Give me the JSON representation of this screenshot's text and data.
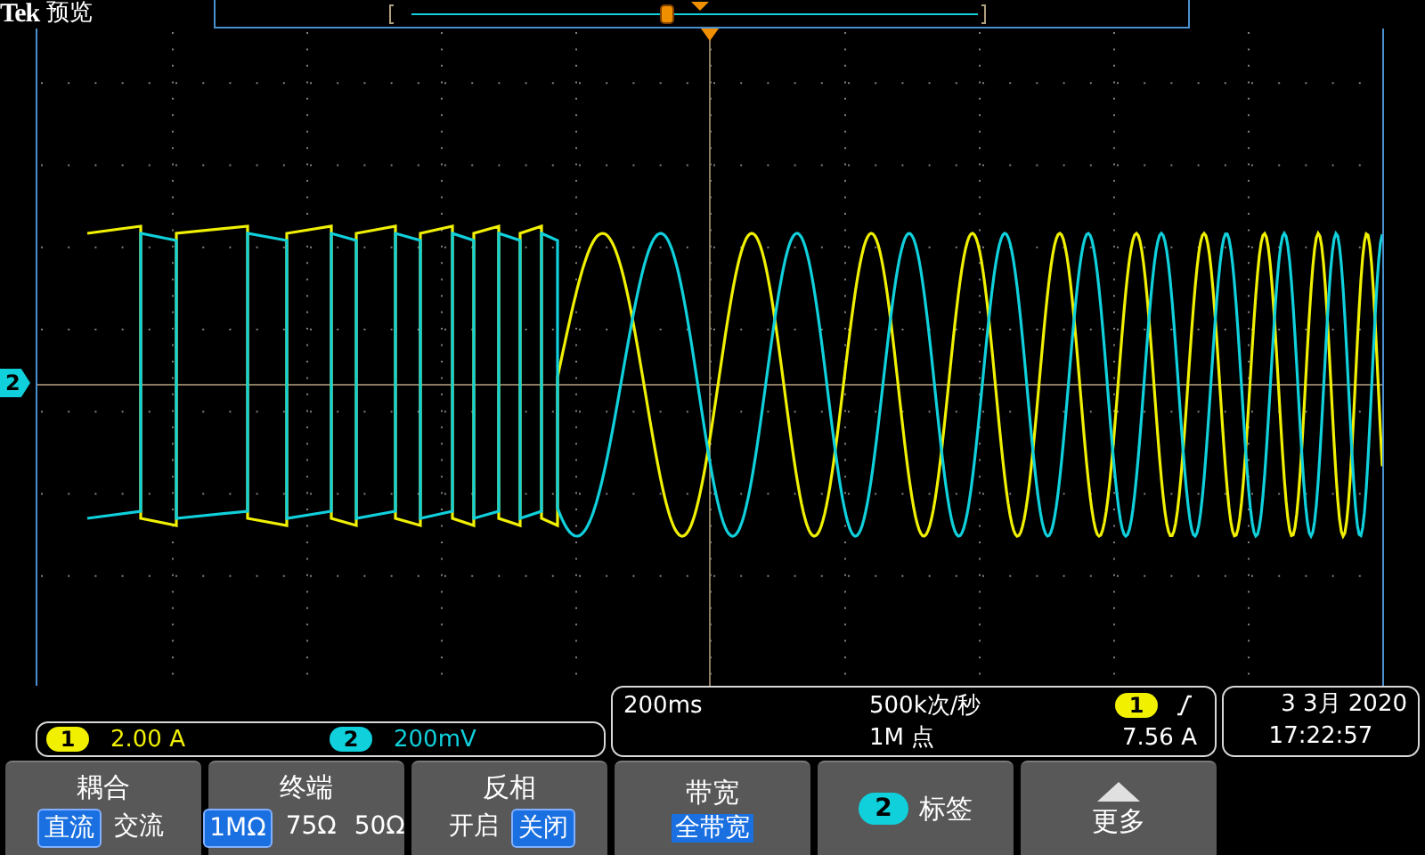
{
  "header": {
    "brand": "Tek",
    "mode": "预览"
  },
  "ground_marker": {
    "label": "2",
    "color": "#10d0dc"
  },
  "channels": [
    {
      "label": "1",
      "scale": "2.00 A",
      "color": "#f0f000"
    },
    {
      "label": "2",
      "scale": "200mV",
      "color": "#10d0dc"
    }
  ],
  "acquisition": {
    "timebase": "200ms",
    "sample_rate": "500k次/秒",
    "record_length": "1M 点",
    "trigger_source": {
      "label": "1",
      "color": "#f0f000"
    },
    "trigger_level": "7.56 A"
  },
  "datetime": {
    "date": "3 3月 2020",
    "time": "17:22:57"
  },
  "menu": [
    {
      "kind": "choice",
      "title": "耦合",
      "options": [
        {
          "label": "直流",
          "selected": true
        },
        {
          "label": "交流",
          "selected": false
        }
      ]
    },
    {
      "kind": "choice",
      "title": "终端",
      "options": [
        {
          "label": "1MΩ",
          "selected": true
        },
        {
          "label": "75Ω",
          "selected": false
        },
        {
          "label": "50Ω",
          "selected": false
        }
      ]
    },
    {
      "kind": "choice",
      "title": "反相",
      "options": [
        {
          "label": "开启",
          "selected": false
        },
        {
          "label": "关闭",
          "selected": true
        }
      ]
    },
    {
      "kind": "value",
      "title": "带宽",
      "value": "全带宽"
    },
    {
      "kind": "label",
      "badge": {
        "label": "2",
        "color": "#10d0dc"
      },
      "title": "标签"
    },
    {
      "kind": "more",
      "title": "更多"
    }
  ]
}
